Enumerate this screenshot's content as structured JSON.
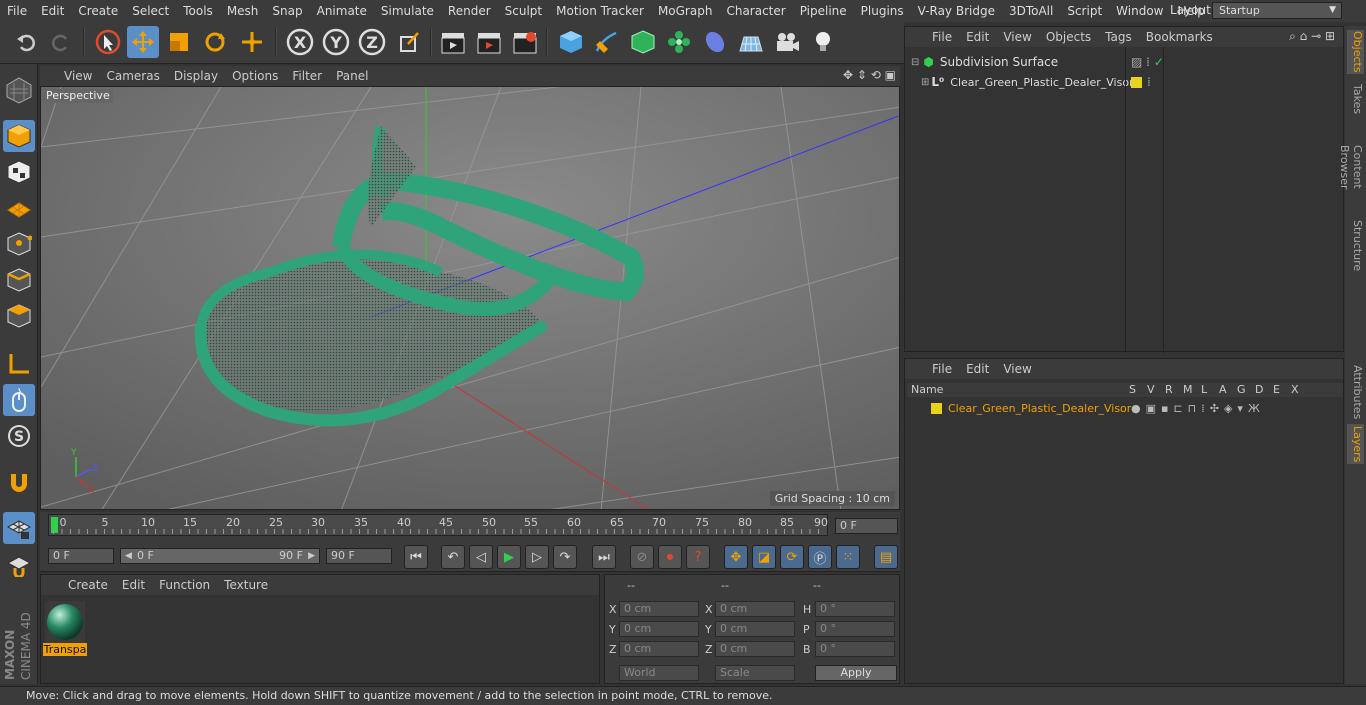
{
  "menubar": {
    "items": [
      "File",
      "Edit",
      "Create",
      "Select",
      "Tools",
      "Mesh",
      "Snap",
      "Animate",
      "Simulate",
      "Render",
      "Sculpt",
      "Motion Tracker",
      "MoGraph",
      "Character",
      "Pipeline",
      "Plugins",
      "V-Ray Bridge",
      "3DToAll",
      "Script",
      "Window",
      "Help"
    ],
    "layout_label": "Layout:",
    "layout_value": "Startup"
  },
  "viewport": {
    "menu": [
      "View",
      "Cameras",
      "Display",
      "Options",
      "Filter",
      "Panel"
    ],
    "label": "Perspective",
    "grid_spacing": "Grid Spacing : 10 cm"
  },
  "timeline": {
    "ticks": [
      "0",
      "5",
      "10",
      "15",
      "20",
      "25",
      "30",
      "35",
      "40",
      "45",
      "50",
      "55",
      "60",
      "65",
      "70",
      "75",
      "80",
      "85",
      "90"
    ],
    "frame_field": "0 F"
  },
  "transport": {
    "start_field": "0 F",
    "range_start": "0 F",
    "range_end": "90 F",
    "end_field": "90 F"
  },
  "material": {
    "menu": [
      "Create",
      "Edit",
      "Function",
      "Texture"
    ],
    "material_name": "Transpa"
  },
  "coords": {
    "headers": [
      "--",
      "--",
      "--"
    ],
    "rows": [
      {
        "a": "X",
        "av": "0 cm",
        "b": "X",
        "bv": "0 cm",
        "c": "H",
        "cv": "0 °"
      },
      {
        "a": "Y",
        "av": "0 cm",
        "b": "Y",
        "bv": "0 cm",
        "c": "P",
        "cv": "0 °"
      },
      {
        "a": "Z",
        "av": "0 cm",
        "b": "Z",
        "bv": "0 cm",
        "c": "B",
        "cv": "0 °"
      }
    ],
    "world": "World",
    "scale": "Scale",
    "apply": "Apply"
  },
  "objects": {
    "menu": [
      "File",
      "Edit",
      "View",
      "Objects",
      "Tags",
      "Bookmarks"
    ],
    "rows": [
      "Subdivision Surface",
      "Clear_Green_Plastic_Dealer_Visor"
    ]
  },
  "layers": {
    "menu": [
      "File",
      "Edit",
      "View"
    ],
    "header_name": "Name",
    "cols": [
      "S",
      "V",
      "R",
      "M",
      "L",
      "A",
      "G",
      "D",
      "E",
      "X"
    ],
    "row": "Clear_Green_Plastic_Dealer_Visor"
  },
  "right_tabs": [
    "Objects",
    "Takes",
    "Content Browser",
    "Structure",
    "Attributes",
    "Layers"
  ],
  "status": "Move: Click and drag to move elements. Hold down SHIFT to quantize movement / add to the selection in point mode, CTRL to remove.",
  "colors": {
    "accent": "#5b8fc7",
    "visor": "#2fa37a",
    "layer": "#e8d21a",
    "highlight": "#f0a000"
  }
}
